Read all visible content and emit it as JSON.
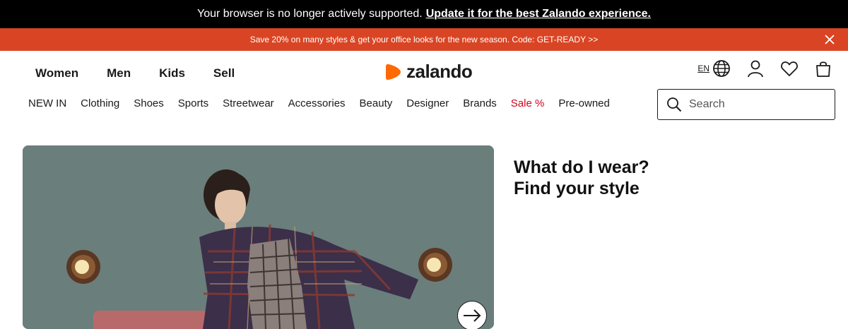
{
  "browser_warning": {
    "text": "Your browser is no longer actively supported.",
    "link": "Update it for the best Zalando experience."
  },
  "promo": {
    "text": "Save 20% on many styles & get your office looks for the new season. Code: GET-READY >>"
  },
  "main_nav": [
    "Women",
    "Men",
    "Kids",
    "Sell"
  ],
  "logo": {
    "text": "zalando",
    "color": "#ff6900"
  },
  "utility": {
    "language": "EN",
    "icons": [
      "globe-icon",
      "account-icon",
      "wishlist-icon",
      "bag-icon"
    ]
  },
  "category_nav": [
    "NEW IN",
    "Clothing",
    "Shoes",
    "Sports",
    "Streetwear",
    "Accessories",
    "Beauty",
    "Designer",
    "Brands",
    "Sale %",
    "Pre-owned"
  ],
  "search": {
    "placeholder": "Search"
  },
  "hero": {
    "headline_1": "What do I wear?",
    "headline_2": "Find your style"
  },
  "colors": {
    "promo_bar": "#d94524",
    "sale": "#d0021b",
    "hero_bg": "#6e8280"
  }
}
